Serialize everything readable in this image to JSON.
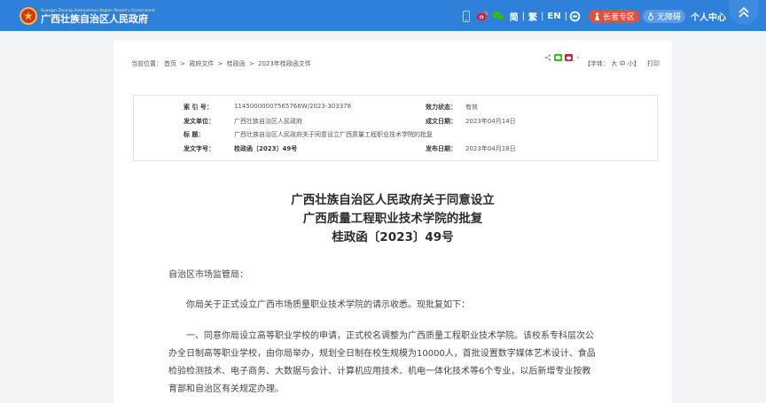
{
  "header": {
    "logo_en": "Guangxi Zhuang Autonomous Region People's Government",
    "logo_cn": "广西壮族自治区人民政府",
    "lang_simplified": "简",
    "lang_traditional": "繁",
    "lang_english": "EN",
    "elder_label": "长者专区",
    "access_label": "无障碍",
    "user_label": "个人中心"
  },
  "breadcrumb": {
    "prefix": "当前位置：",
    "items": [
      "首页",
      "政府文件",
      "桂政函",
      "2023年桂政函文件"
    ],
    "separator": " > "
  },
  "font_control": {
    "open": "【字体：",
    "large": "大",
    "medium": "中",
    "small": "小",
    "close": "】",
    "print": "打印"
  },
  "meta": {
    "index_key": "索  引  号：",
    "index_val": "11450000007565768W/2023-303378",
    "status_key": "效力状态：",
    "status_val": "有效",
    "issuer_key": "发文单位：",
    "issuer_val": "广西壮族自治区人民政府",
    "date_key": "成文日期：",
    "date_val": "2023年04月14日",
    "title_key": "标      题：",
    "title_val": "广西壮族自治区人民政府关于同意设立广西质量工程职业技术学院的批复",
    "docno_key": "发文字号：",
    "docno_val": "桂政函〔2023〕49号",
    "pub_key": "发布日期：",
    "pub_val": "2023年04月18日"
  },
  "document": {
    "title_line1": "广西壮族自治区人民政府关于同意设立",
    "title_line2": "广西质量工程职业技术学院的批复",
    "title_line3": "桂政函〔2023〕49号",
    "salutation": "自治区市场监管局：",
    "para1": "你局关于正式设立广西市场质量职业技术学院的请示收悉。现批复如下：",
    "para2_line1": "一、同意你局设立高等职业学校的申请，正式校名调整为广西质量工程职业技术学院。该校系专科层次公",
    "para2_line2": "办全日制高等职业学校，由你局举办，规划全日制在校生规模为10000人，首批设置数字媒体艺术设计、食品",
    "para2_line3": "检验检测技术、电子商务、大数据与会计、计算机应用技术、机电一体化技术等6个专业，以后新增专业按教",
    "para2_line4": "育部和自治区有关规定办理。"
  },
  "colors": {
    "header_bg": "#2f80d9",
    "elder_badge": "#e84d3b",
    "access_badge": "#5a9de6"
  }
}
